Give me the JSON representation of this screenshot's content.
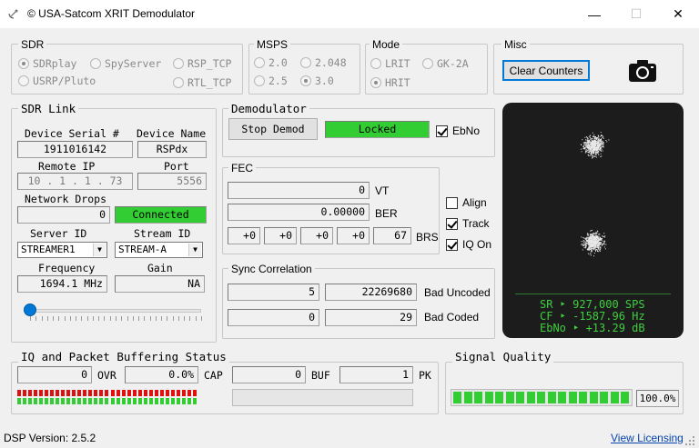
{
  "window": {
    "title": "© USA-Satcom XRIT Demodulator",
    "minimize": "—",
    "maximize": "☐",
    "close": "✕"
  },
  "sdr": {
    "label": "SDR",
    "options": [
      {
        "label": "SDRplay",
        "selected": true
      },
      {
        "label": "SpyServer",
        "selected": false
      },
      {
        "label": "RSP_TCP",
        "selected": false
      },
      {
        "label": "USRP/Pluto",
        "selected": false
      },
      {
        "label": "RTL_TCP",
        "selected": false
      }
    ]
  },
  "msps": {
    "label": "MSPS",
    "options": [
      {
        "label": "2.0",
        "selected": false
      },
      {
        "label": "2.048",
        "selected": false
      },
      {
        "label": "2.5",
        "selected": false
      },
      {
        "label": "3.0",
        "selected": true
      }
    ]
  },
  "mode": {
    "label": "Mode",
    "options": [
      {
        "label": "LRIT",
        "selected": false
      },
      {
        "label": "GK-2A",
        "selected": false
      },
      {
        "label": "HRIT",
        "selected": true
      }
    ]
  },
  "misc": {
    "label": "Misc",
    "clear_counters": "Clear Counters",
    "camera_icon": "camera-icon"
  },
  "sdr_link": {
    "label": "SDR Link",
    "device_serial_label": "Device Serial #",
    "device_serial": "1911016142",
    "device_name_label": "Device Name",
    "device_name": "RSPdx",
    "remote_ip_label": "Remote IP",
    "remote_ip": "10 . 1 . 1 . 73",
    "port_label": "Port",
    "port": "5556",
    "network_drops_label": "Network Drops",
    "network_drops": "0",
    "connection_status": "Connected",
    "server_id_label": "Server ID",
    "server_id": "STREAMER1",
    "stream_id_label": "Stream ID",
    "stream_id": "STREAM-A",
    "frequency_label": "Frequency",
    "frequency": "1694.1 MHz",
    "gain_label": "Gain",
    "gain": "NA",
    "slider_value": 0
  },
  "demodulator": {
    "label": "Demodulator",
    "stop_button": "Stop Demod",
    "lock_status": "Locked",
    "ebno_label": "EbNo",
    "ebno_checked": true
  },
  "fec": {
    "label": "FEC",
    "vt_value": "0",
    "vt_label": "VT",
    "ber_value": "0.00000",
    "ber_label": "BER",
    "brs_values": [
      "+0",
      "+0",
      "+0",
      "+0",
      "67"
    ],
    "brs_label": "BRS"
  },
  "options": {
    "align": {
      "label": "Align",
      "checked": false
    },
    "track": {
      "label": "Track",
      "checked": true
    },
    "iq_on": {
      "label": "IQ On",
      "checked": true
    }
  },
  "sync": {
    "label": "Sync Correlation",
    "bad_uncoded_a": "5",
    "bad_uncoded_b": "22269680",
    "bad_uncoded_label": "Bad Uncoded",
    "bad_coded_a": "0",
    "bad_coded_b": "29",
    "bad_coded_label": "Bad Coded"
  },
  "constellation": {
    "sr": "SR ‣ 927,000 SPS",
    "cf": "CF ‣ -1587.96 Hz",
    "ebno": "EbNo ‣ +13.29 dB"
  },
  "iq_buffer": {
    "label": "IQ and Packet Buffering Status",
    "ovr_value": "0",
    "ovr_label": "OVR",
    "cap_value": "0.0%",
    "cap_label": "CAP",
    "buf_value": "0",
    "buf_label": "BUF",
    "pk_value": "1",
    "pk_label": "PK",
    "meter_red_fraction": 1.0,
    "meter_green_fraction": 1.0,
    "buffer_fill_fraction": 0.0
  },
  "signal_quality": {
    "label": "Signal Quality",
    "value": "100.0%",
    "fill_fraction": 1.0
  },
  "status_bar": {
    "dsp_version": "DSP Version: 2.5.2",
    "licensing_link": "View Licensing"
  },
  "colors": {
    "green": "#32cd32",
    "meter_red": "#e01010",
    "constellation_bg": "#1c1c1c",
    "stats_green": "#3ecf3e"
  }
}
